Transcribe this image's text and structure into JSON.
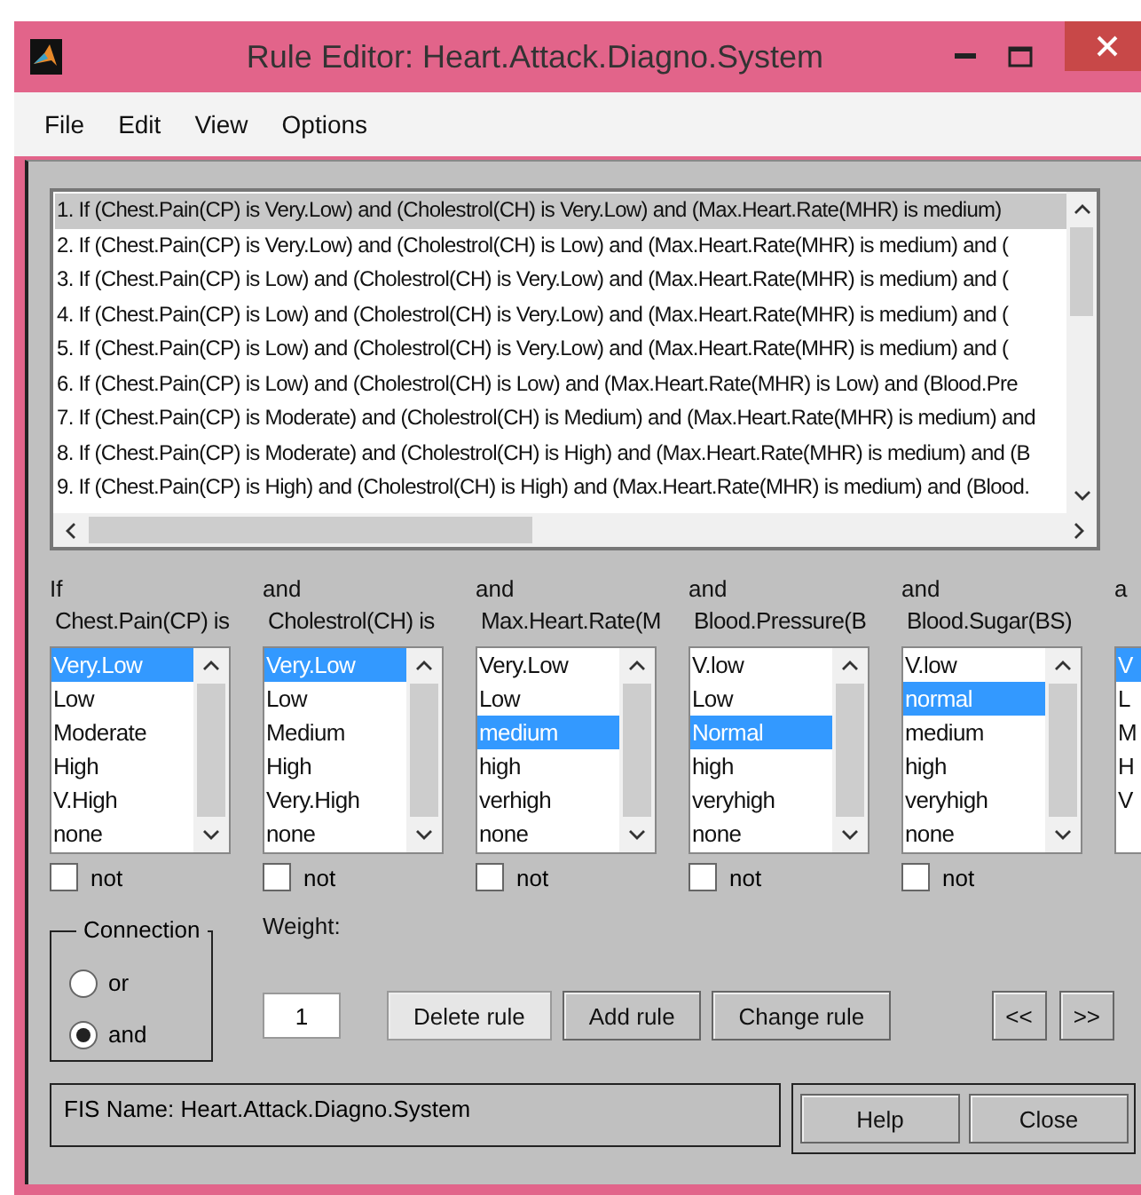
{
  "window": {
    "title": "Rule Editor: Heart.Attack.Diagno.System"
  },
  "menu": [
    "File",
    "Edit",
    "View",
    "Options"
  ],
  "rules": [
    {
      "text": "1. If (Chest.Pain(CP) is Very.Low) and (Cholestrol(CH) is Very.Low) and (Max.Heart.Rate(MHR) is medium)",
      "selected": true
    },
    {
      "text": "2. If (Chest.Pain(CP) is Very.Low) and (Cholestrol(CH) is Low) and (Max.Heart.Rate(MHR) is medium) and (",
      "selected": false
    },
    {
      "text": "3. If (Chest.Pain(CP) is Low) and (Cholestrol(CH) is Very.Low) and (Max.Heart.Rate(MHR) is medium) and (",
      "selected": false
    },
    {
      "text": "4. If (Chest.Pain(CP) is Low) and (Cholestrol(CH) is Very.Low) and (Max.Heart.Rate(MHR) is medium) and (",
      "selected": false
    },
    {
      "text": "5. If (Chest.Pain(CP) is Low) and (Cholestrol(CH) is Very.Low) and (Max.Heart.Rate(MHR) is medium) and (",
      "selected": false
    },
    {
      "text": "6. If (Chest.Pain(CP) is Low) and (Cholestrol(CH) is Low) and (Max.Heart.Rate(MHR) is Low) and (Blood.Pre",
      "selected": false
    },
    {
      "text": "7. If (Chest.Pain(CP) is Moderate) and (Cholestrol(CH) is Medium) and (Max.Heart.Rate(MHR) is medium) and",
      "selected": false
    },
    {
      "text": "8. If (Chest.Pain(CP) is Moderate) and (Cholestrol(CH) is High) and (Max.Heart.Rate(MHR) is medium) and (B",
      "selected": false
    },
    {
      "text": "9. If (Chest.Pain(CP) is High) and (Cholestrol(CH) is High) and (Max.Heart.Rate(MHR) is medium) and (Blood.",
      "selected": false
    }
  ],
  "antecedents": [
    {
      "connective": "If",
      "variable": "Chest.Pain(CP) is",
      "not": false,
      "not_label": "not",
      "options": [
        {
          "label": "Very.Low",
          "selected": true
        },
        {
          "label": "Low",
          "selected": false
        },
        {
          "label": "Moderate",
          "selected": false
        },
        {
          "label": "High",
          "selected": false
        },
        {
          "label": "V.High",
          "selected": false
        },
        {
          "label": "none",
          "selected": false
        }
      ]
    },
    {
      "connective": "and",
      "variable": "Cholestrol(CH) is",
      "not": false,
      "not_label": "not",
      "options": [
        {
          "label": "Very.Low",
          "selected": true
        },
        {
          "label": "Low",
          "selected": false
        },
        {
          "label": "Medium",
          "selected": false
        },
        {
          "label": "High",
          "selected": false
        },
        {
          "label": "Very.High",
          "selected": false
        },
        {
          "label": "none",
          "selected": false
        }
      ]
    },
    {
      "connective": "and",
      "variable": "Max.Heart.Rate(M",
      "not": false,
      "not_label": "not",
      "options": [
        {
          "label": "Very.Low",
          "selected": false
        },
        {
          "label": "Low",
          "selected": false
        },
        {
          "label": "medium",
          "selected": true
        },
        {
          "label": "high",
          "selected": false
        },
        {
          "label": "verhigh",
          "selected": false
        },
        {
          "label": "none",
          "selected": false
        }
      ]
    },
    {
      "connective": "and",
      "variable": "Blood.Pressure(B",
      "not": false,
      "not_label": "not",
      "options": [
        {
          "label": "V.low",
          "selected": false
        },
        {
          "label": "Low",
          "selected": false
        },
        {
          "label": "Normal",
          "selected": true
        },
        {
          "label": "high",
          "selected": false
        },
        {
          "label": "veryhigh",
          "selected": false
        },
        {
          "label": "none",
          "selected": false
        }
      ]
    },
    {
      "connective": "and",
      "variable": "Blood.Sugar(BS)",
      "not": false,
      "not_label": "not",
      "options": [
        {
          "label": "V.low",
          "selected": false
        },
        {
          "label": "normal",
          "selected": true
        },
        {
          "label": "medium",
          "selected": false
        },
        {
          "label": "high",
          "selected": false
        },
        {
          "label": "veryhigh",
          "selected": false
        },
        {
          "label": "none",
          "selected": false
        }
      ]
    },
    {
      "connective": "a",
      "options": [
        {
          "label": "V",
          "selected": true
        },
        {
          "label": "L",
          "selected": false
        },
        {
          "label": "M",
          "selected": false
        },
        {
          "label": "H",
          "selected": false
        },
        {
          "label": "V",
          "selected": false
        }
      ]
    }
  ],
  "connection": {
    "title": "Connection",
    "options": [
      {
        "label": "or",
        "selected": false
      },
      {
        "label": "and",
        "selected": true
      }
    ]
  },
  "weight": {
    "label": "Weight:",
    "value": "1"
  },
  "buttons": [
    {
      "label": "Delete rule",
      "focused": true
    },
    {
      "label": "Add rule",
      "focused": false
    },
    {
      "label": "Change rule",
      "focused": false
    }
  ],
  "nav_buttons": [
    "<<",
    ">>"
  ],
  "status": "FIS Name: Heart.Attack.Diagno.System",
  "footer_buttons": [
    "Help",
    "Close"
  ]
}
